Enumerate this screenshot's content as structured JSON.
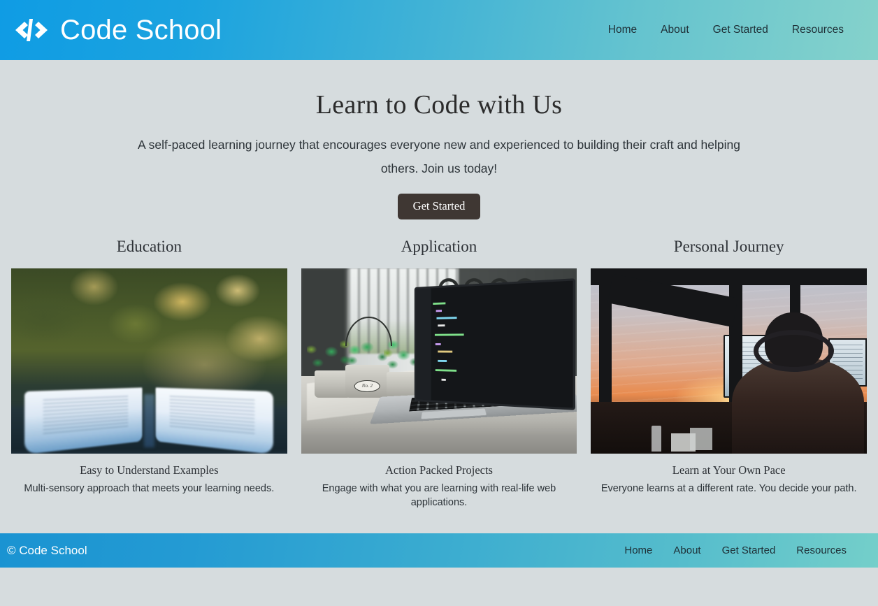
{
  "header": {
    "logo_icon": "code-brackets-icon",
    "brand": "Code School",
    "nav": [
      {
        "label": "Home"
      },
      {
        "label": "About"
      },
      {
        "label": "Get Started"
      },
      {
        "label": "Resources"
      }
    ],
    "gradient_from": "#0f9ce4",
    "gradient_to": "#85d2cb"
  },
  "hero": {
    "title": "Learn to Code with Us",
    "subtitle": "A self-paced learning journey that encourages everyone new and experienced to building their craft and helping others. Join us today!",
    "cta_label": "Get Started",
    "cta_color": "#3f3733"
  },
  "cards": [
    {
      "heading": "Education",
      "image_alt": "open-book-on-table-with-bokeh-foliage",
      "subtitle": "Easy to Understand Examples",
      "text": "Multi-sensory approach that meets your learning needs."
    },
    {
      "heading": "Application",
      "image_alt": "laptop-with-code-editor-on-windowsill-desk",
      "subtitle": "Action Packed Projects",
      "text": "Engage with what you are learning with real-life web applications.",
      "pot_label": "No. 2"
    },
    {
      "heading": "Personal Journey",
      "image_alt": "person-with-headphones-at-computer-during-sunset",
      "subtitle": "Learn at Your Own Pace",
      "text": "Everyone learns at a different rate. You decide your path."
    }
  ],
  "footer": {
    "copyright": "© Code School",
    "nav": [
      {
        "label": "Home"
      },
      {
        "label": "About"
      },
      {
        "label": "Get Started"
      },
      {
        "label": "Resources"
      }
    ]
  },
  "page": {
    "background": "#d6dcde"
  }
}
